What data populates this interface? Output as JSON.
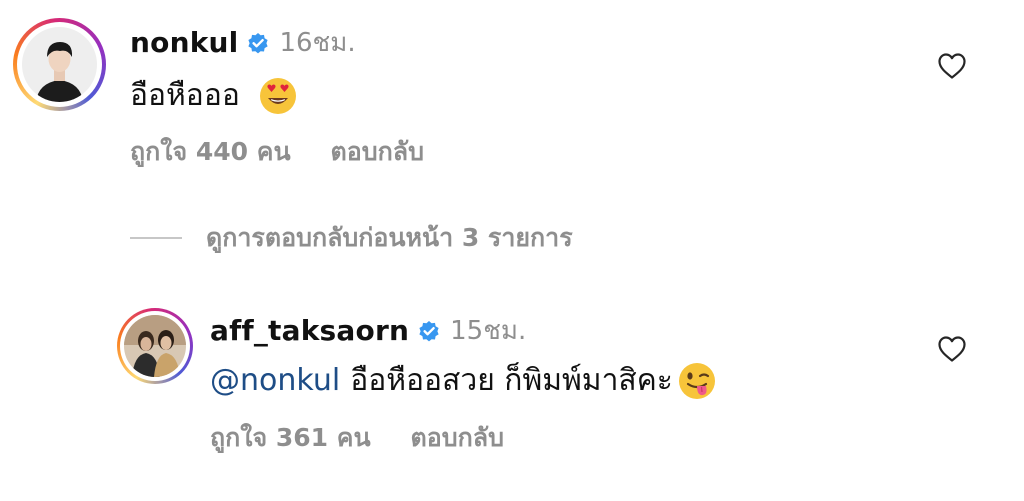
{
  "comments": [
    {
      "username": "nonkul",
      "time": "16ชม.",
      "text": "อือหือออ",
      "emoji_icon": "heart-eyes-emoji-icon",
      "likes": "ถูกใจ 440 คน",
      "reply": "ตอบกลับ"
    },
    {
      "username": "aff_taksaorn",
      "time": "15ชม.",
      "mention": "@nonkul",
      "text": "อือหืออสวย ก็พิมพ์มาสิคะ",
      "emoji_icon": "winking-tongue-emoji-icon",
      "likes": "ถูกใจ 361 คน",
      "reply": "ตอบกลับ"
    }
  ],
  "view_replies": "ดูการตอบกลับก่อนหน้า 3 รายการ",
  "colors": {
    "verified": "#3897f0",
    "mention": "#1e4d86",
    "muted": "#8e8e8e"
  }
}
